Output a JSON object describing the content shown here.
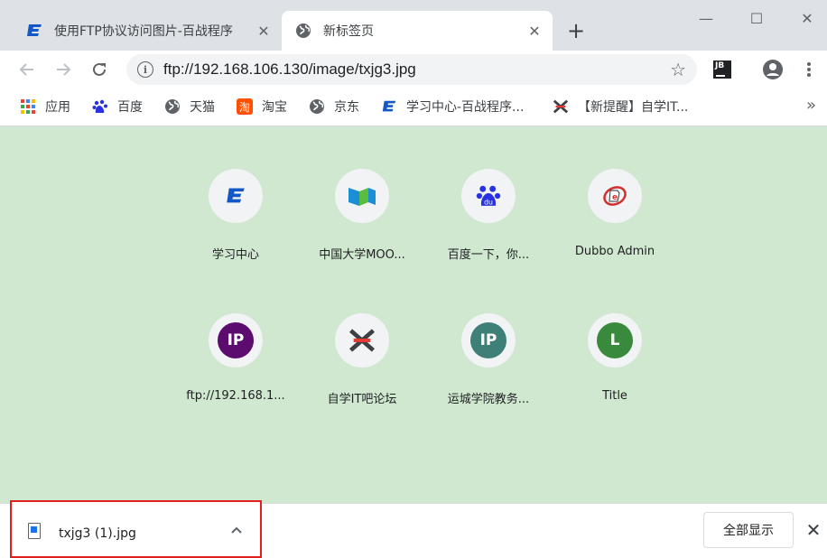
{
  "tabs": [
    {
      "title": "使用FTP协议访问图片-百战程序",
      "icon": "baizhan-logo-icon"
    },
    {
      "title": "新标签页",
      "icon": "globe-icon"
    }
  ],
  "window_controls": {
    "minimize": "—",
    "maximize": "☐",
    "close": "✕"
  },
  "toolbar": {
    "url": "ftp://192.168.106.130/image/txjg3.jpg",
    "extension_label": "JB"
  },
  "bookmarks": [
    {
      "label": "应用",
      "icon": "apps-grid-icon"
    },
    {
      "label": "百度",
      "icon": "baidu-paw-icon"
    },
    {
      "label": "天猫",
      "icon": "globe-icon"
    },
    {
      "label": "淘宝",
      "icon": "taobao-icon"
    },
    {
      "label": "京东",
      "icon": "globe-icon"
    },
    {
      "label": "学习中心-百战程序...",
      "icon": "baizhan-logo-icon"
    },
    {
      "label": "【新提醒】自学IT...",
      "icon": "zixue-x-icon"
    }
  ],
  "bookmarks_more": "»",
  "shortcuts": [
    {
      "label": "学习中心",
      "icon": "baizhan-logo-icon"
    },
    {
      "label": "中国大学MOO...",
      "icon": "mooc-icon"
    },
    {
      "label": "百度一下，你...",
      "icon": "baidu-paw-icon"
    },
    {
      "label": "Dubbo Admin",
      "icon": "dubbo-icon"
    },
    {
      "label": "ftp://192.168.1...",
      "letter": "IP",
      "color": "#5c0b6e"
    },
    {
      "label": "自学IT吧论坛",
      "icon": "zixue-x-icon"
    },
    {
      "label": "运城学院教务...",
      "letter": "IP",
      "color": "#3e7f78"
    },
    {
      "label": "Title",
      "letter": "L",
      "color": "#3a8a3e"
    }
  ],
  "download": {
    "filename": "txjg3 (1).jpg",
    "show_all": "全部显示"
  },
  "colors": {
    "content_bg": "#cfe8cf",
    "highlight": "#e0201e"
  }
}
